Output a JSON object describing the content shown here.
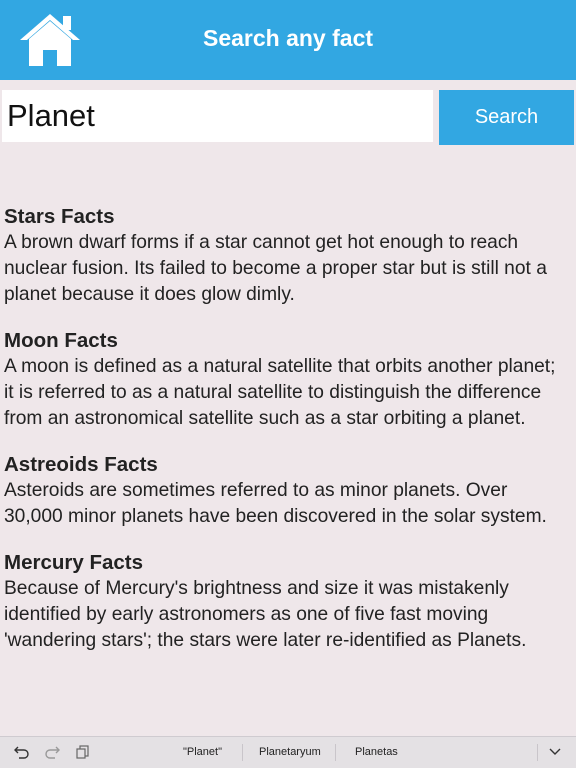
{
  "header": {
    "home_icon": "home-icon",
    "title": "Search any fact",
    "colors": {
      "accent": "#32a7e2",
      "text": "#ffffff"
    }
  },
  "search": {
    "value": "Planet",
    "button_label": "Search"
  },
  "facts": [
    {
      "title": "Stars Facts",
      "body": "A brown dwarf forms if a star cannot get hot enough to reach nuclear fusion. Its failed to become a proper star but is still not a planet because it does glow dimly."
    },
    {
      "title": "Moon Facts",
      "body": "A moon is defined as a natural satellite that orbits another planet; it is referred to as a natural satellite to distinguish the difference from an astronomical satellite such as a star orbiting a planet."
    },
    {
      "title": "Astreoids Facts",
      "body": "Asteroids are sometimes referred to as minor planets. Over 30,000 minor planets have been discovered in the solar system."
    },
    {
      "title": "Mercury Facts",
      "body": "Because of Mercury's brightness and size it was mistakenly identified by early astronomers as one of five fast moving 'wandering stars'; the stars were later re-identified as Planets."
    }
  ],
  "keyboard_toolbar": {
    "icons": [
      "undo-icon",
      "redo-icon",
      "paste-icon",
      "chevron-down-icon"
    ],
    "suggestions": [
      "\"Planet\"",
      "Planetaryum",
      "Planetas"
    ]
  },
  "colors": {
    "background": "#efe7ea",
    "toolbar": "#e4e1e4"
  }
}
